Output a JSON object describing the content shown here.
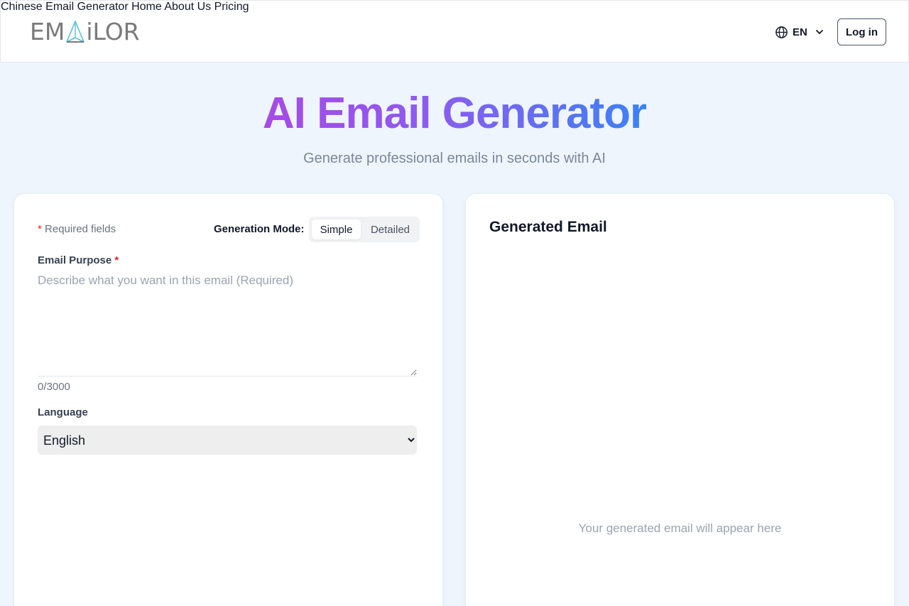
{
  "header": {
    "logo_text_left": "EM",
    "logo_text_right": "iLOR",
    "nav": [
      {
        "label": "Chinese Email Generator"
      },
      {
        "label": "Home"
      },
      {
        "label": "About Us"
      },
      {
        "label": "Pricing"
      }
    ],
    "language": "EN",
    "login_label": "Log in"
  },
  "hero": {
    "title": "AI Email Generator",
    "subtitle": "Generate professional emails in seconds with AI"
  },
  "form": {
    "required_star": "*",
    "required_text": "Required fields",
    "mode_label": "Generation Mode:",
    "mode_options": [
      "Simple",
      "Detailed"
    ],
    "mode_selected": "Simple",
    "purpose_label": "Email Purpose",
    "purpose_placeholder": "Describe what you want in this email (Required)",
    "purpose_value": "",
    "counter": "0/3000",
    "language_label": "Language",
    "language_selected": "English"
  },
  "output": {
    "title": "Generated Email",
    "placeholder": "Your generated email will appear here"
  },
  "colors": {
    "background": "#eef5fd",
    "title_gradient_start": "#a849e9",
    "title_gradient_end": "#3b82f6",
    "required_star": "#dc2626",
    "logo_accent": "#5bc0d8"
  },
  "icons": {
    "language": "globe-icon",
    "language_toggle": "chevron-down-icon",
    "logo_mark": "paper-plane-icon"
  }
}
